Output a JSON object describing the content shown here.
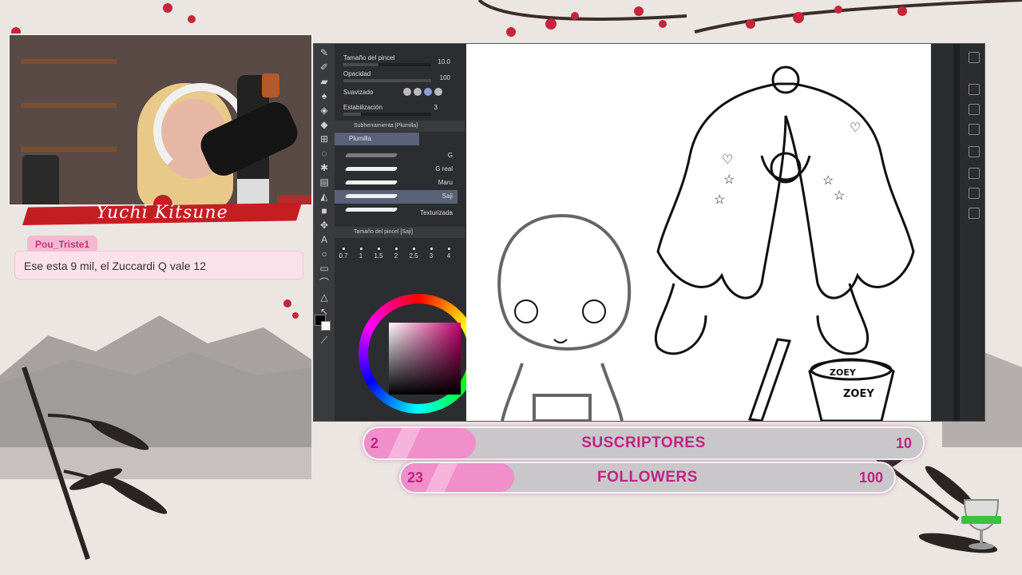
{
  "streamer": {
    "name": "Yuchi Kitsune"
  },
  "chat": {
    "username": "Pou_Triste1",
    "message": "Ese esta 9 mil, el Zuccardi Q vale 12"
  },
  "app": {
    "properties": {
      "brush_size": {
        "label": "Tamaño del pincel",
        "value": "10.0"
      },
      "opacity": {
        "label": "Opacidad",
        "value": "100"
      },
      "smoothing": {
        "label": "Suavizado"
      },
      "stabilization": {
        "label": "Estabilización",
        "value": "3"
      }
    },
    "subtool_header": "Subherramienta [Plumilla]",
    "subtool_tab": "Plumilla",
    "brushes": [
      {
        "name": "G"
      },
      {
        "name": "G real"
      },
      {
        "name": "Maru"
      },
      {
        "name": "Saji"
      },
      {
        "name": "Texturizada"
      }
    ],
    "size_header": "Tamaño del pincel [Saji]",
    "sizes": [
      "0.7",
      "1",
      "1.5",
      "2",
      "2.5",
      "3",
      "4"
    ],
    "colors": {
      "accent": "#596277",
      "main_color": "#000000",
      "sub_color": "#ffffff"
    }
  },
  "goals": {
    "subscribers": {
      "current": "2",
      "label": "SUSCRIPTORES",
      "target": "10",
      "progress": 0.2
    },
    "followers": {
      "current": "23",
      "label": "FOLLOWERS",
      "target": "100",
      "progress": 0.23
    }
  },
  "icons": [
    "pen-icon",
    "eraser-icon",
    "fill-icon",
    "text-icon",
    "selection-icon",
    "eyedropper-icon"
  ]
}
